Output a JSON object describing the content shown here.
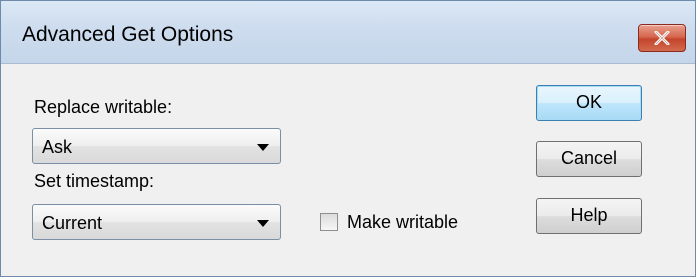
{
  "window": {
    "title": "Advanced Get Options",
    "close_icon": "close-icon"
  },
  "replace_writable": {
    "label": "Replace writable:",
    "selected": "Ask"
  },
  "set_timestamp": {
    "label": "Set timestamp:",
    "selected": "Current"
  },
  "make_writable": {
    "label": "Make writable",
    "checked": false
  },
  "buttons": {
    "ok": "OK",
    "cancel": "Cancel",
    "help": "Help"
  },
  "colors": {
    "title_bar": "#cddcee",
    "close_button": "#c3452c",
    "dialog_bg": "#f0f0f0",
    "default_button_border": "#3c7fb1"
  }
}
